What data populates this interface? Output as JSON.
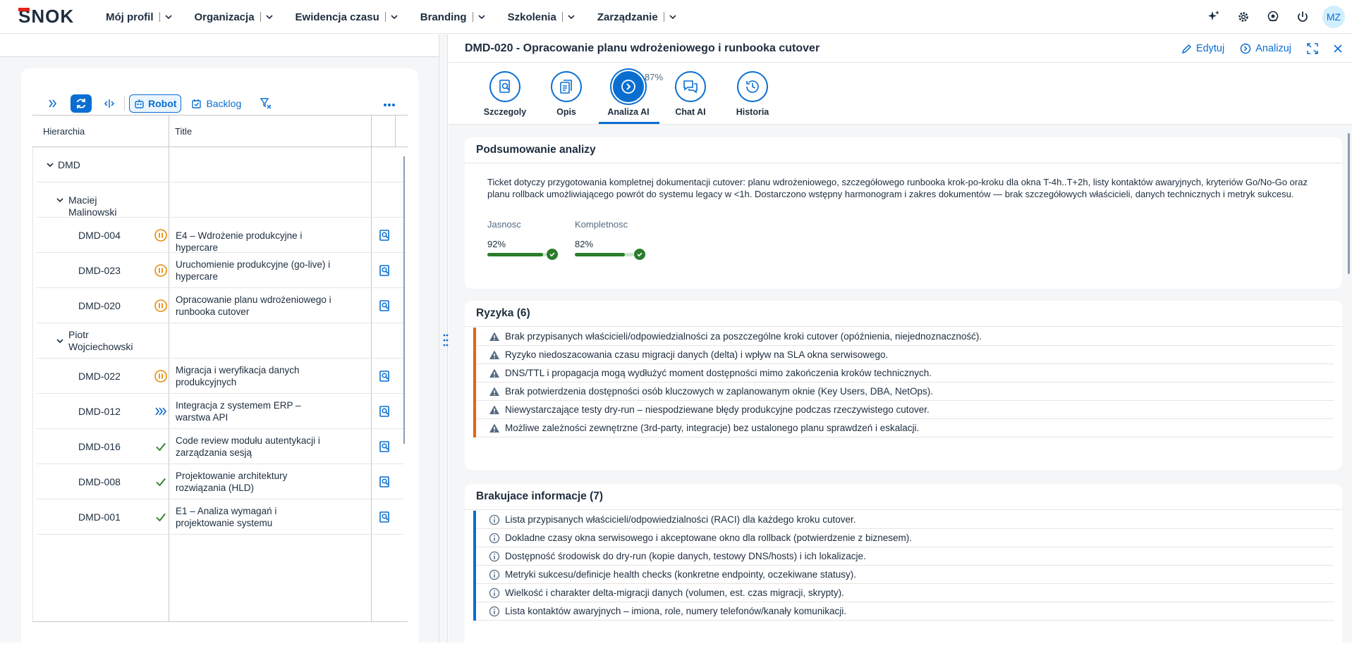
{
  "app": {
    "logo_text": "SNOK",
    "nav": [
      {
        "label": "Mój profil"
      },
      {
        "label": "Organizacja"
      },
      {
        "label": "Ewidencja czasu"
      },
      {
        "label": "Branding"
      },
      {
        "label": "Szkolenia"
      },
      {
        "label": "Zarządzanie"
      }
    ],
    "user_initials": "MZ"
  },
  "left": {
    "toolbar": {
      "robot_label": "Robot",
      "backlog_label": "Backlog"
    },
    "columns": {
      "hierarchy": "Hierarchia",
      "title": "Title"
    },
    "rows": [
      {
        "name": "DMD",
        "title": "",
        "status": "",
        "level": 0
      },
      {
        "name": "Maciej Malinowski",
        "title": "",
        "status": "",
        "level": 1
      },
      {
        "name": "DMD-004",
        "title": "E4 – Wdrożenie produkcyjne i hypercare",
        "status": "paused",
        "level": 2
      },
      {
        "name": "DMD-023",
        "title": "Uruchomienie produkcyjne (go-live) i hypercare",
        "status": "paused",
        "level": 2
      },
      {
        "name": "DMD-020",
        "title": "Opracowanie planu wdrożeniowego i runbooka cutover",
        "status": "paused",
        "level": 2
      },
      {
        "name": "Piotr Wojciechowski",
        "title": "",
        "status": "",
        "level": 1
      },
      {
        "name": "DMD-022",
        "title": "Migracja i weryfikacja danych produkcyjnych",
        "status": "paused",
        "level": 2
      },
      {
        "name": "DMD-012",
        "title": "Integracja z systemem ERP – warstwa API",
        "status": "in-progress",
        "level": 2
      },
      {
        "name": "DMD-016",
        "title": "Code review modułu autentykacji i zarządzania sesją",
        "status": "done",
        "level": 2
      },
      {
        "name": "DMD-008",
        "title": "Projektowanie architektury rozwiązania (HLD)",
        "status": "done",
        "level": 2
      },
      {
        "name": "DMD-001",
        "title": "E1 – Analiza wymagań i projektowanie systemu",
        "status": "done",
        "level": 2
      }
    ]
  },
  "right": {
    "title": "DMD-020 - Opracowanie planu wdrożeniowego i runbooka cutover",
    "edit_label": "Edytuj",
    "analyze_label": "Analizuj",
    "tabs": [
      {
        "label": "Szczegoly"
      },
      {
        "label": "Opis"
      },
      {
        "label": "Analiza AI"
      },
      {
        "label": "Chat AI"
      },
      {
        "label": "Historia"
      }
    ],
    "ai_percent": "87%",
    "summary": {
      "title": "Podsumowanie analizy",
      "text": "Ticket dotyczy przygotowania kompletnej dokumentacji cutover: planu wdrożeniowego, szczegółowego runbooka krok-po-kroku dla okna T-4h..T+2h, listy kontaktów awaryjnych, kryteriów Go/No-Go oraz planu rollback umożliwiającego powrót do systemu legacy w <1h. Dostarczono wstępny harmonogram i zakres dokumentów — brak szczegółowych właścicieli, danych technicznych i metryk sukcesu.",
      "metrics": [
        {
          "label": "Jasnosc",
          "value": "92%",
          "fraction": 0.92
        },
        {
          "label": "Kompletnosc",
          "value": "82%",
          "fraction": 0.82
        }
      ]
    },
    "risks": {
      "title": "Ryzyka (6)",
      "items": [
        "Brak przypisanych właścicieli/odpowiedzialności za poszczególne kroki cutover (opóźnienia, niejednoznaczność).",
        "Ryzyko niedoszacowania czasu migracji danych (delta) i wpływ na SLA okna serwisowego.",
        "DNS/TTL i propagacja mogą wydłużyć moment dostępności mimo zakończenia kroków technicznych.",
        "Brak potwierdzenia dostępności osób kluczowych w zaplanowanym oknie (Key Users, DBA, NetOps).",
        "Niewystarczające testy dry-run – niespodziewane błędy produkcyjne podczas rzeczywistego cutover.",
        "Możliwe zależności zewnętrzne (3rd-party, integracje) bez ustalonego planu sprawdzeń i eskalacji."
      ]
    },
    "missing": {
      "title": "Brakujace informacje (7)",
      "items": [
        "Lista przypisanych właścicieli/odpowiedzialności (RACI) dla każdego kroku cutover.",
        "Dokladne czasy okna serwisowego i akceptowane okno dla rollback (potwierdzenie z biznesem).",
        "Dostępność środowisk do dry-run (kopie danych, testowy DNS/hosts) i ich lokalizacje.",
        "Metryki sukcesu/definicje health checks (konkretne endpointy, oczekiwane statusy).",
        "Wielkość i charakter delta-migracji danych (volumen, est. czas migracji, skrypty).",
        "Lista kontaktów awaryjnych – imiona, role, numery telefonów/kanały komunikacji."
      ]
    },
    "colors": {
      "accent": "#0a6ed1",
      "risk": "#e76500",
      "ok": "#2b7d2b",
      "warn": "#e78c07"
    }
  }
}
